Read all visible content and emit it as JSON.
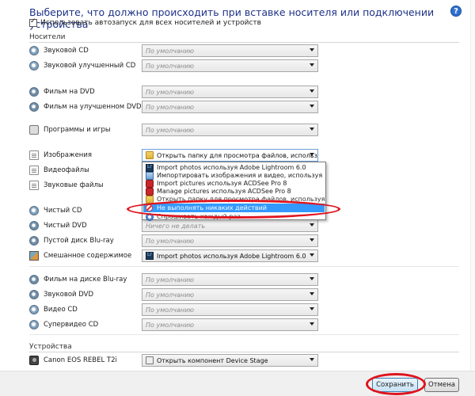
{
  "header": {
    "title": "Выберите, что должно происходить при вставке носителя или подключении устройства",
    "help_label": "?",
    "autoplay_label": "Использовать автозапуск для всех носителей и устройств"
  },
  "sections": {
    "media": "Носители",
    "devices": "Устройства"
  },
  "rows": [
    {
      "label": "Звуковой CD",
      "value": "По умолчанию",
      "icon": "cd-disc-icon"
    },
    {
      "label": "Звуковой улучшенный CD",
      "value": "По умолчанию",
      "icon": "cd-disc-icon"
    },
    {
      "label": "Фильм на DVD",
      "value": "По умолчанию",
      "icon": "dvd-disc-icon"
    },
    {
      "label": "Фильм на улучшенном DVD",
      "value": "По умолчанию",
      "icon": "dvd-disc-icon"
    },
    {
      "label": "Программы и игры",
      "value": "По умолчанию",
      "icon": "program-icon"
    },
    {
      "label": "Изображения",
      "value": "Открыть папку для просмотра файлов, используя Пров",
      "icon": "document-icon"
    },
    {
      "label": "Видеофайлы",
      "value": "",
      "icon": "document-icon"
    },
    {
      "label": "Звуковые файлы",
      "value": "",
      "icon": "document-icon"
    },
    {
      "label": "Чистый CD",
      "value": "",
      "icon": "cd-disc-icon"
    },
    {
      "label": "Чистый DVD",
      "value": "Ничего не делать",
      "icon": "dvd-disc-icon"
    },
    {
      "label": "Пустой диск Blu-ray",
      "value": "По умолчанию",
      "icon": "bluray-disc-icon"
    },
    {
      "label": "Смешанное содержимое",
      "value": "Import photos используя Adobe Lightroom 6.0",
      "icon": "mixed-content-icon"
    },
    {
      "label": "Фильм на диске Blu-ray",
      "value": "По умолчанию",
      "icon": "bluray-disc-icon"
    },
    {
      "label": "Звуковой DVD",
      "value": "По умолчанию",
      "icon": "dvd-disc-icon"
    },
    {
      "label": "Видео CD",
      "value": "По умолчанию",
      "icon": "cd-disc-icon"
    },
    {
      "label": "Супервидео CD",
      "value": "По умолчанию",
      "icon": "cd-disc-icon"
    }
  ],
  "dropdown": {
    "items": [
      {
        "label": "Import photos используя Adobe Lightroom 6.0",
        "icon": "lightroom-icon"
      },
      {
        "label": "Импортировать изображения и видео, используя Windows",
        "icon": "windows-import-icon"
      },
      {
        "label": "Import pictures используя ACDSee Pro 8",
        "icon": "acdsee-icon"
      },
      {
        "label": "Manage pictures используя ACDSee Pro 8",
        "icon": "acdsee-icon"
      },
      {
        "label": "Открыть папку для просмотра файлов, используя Проводник",
        "icon": "folder-icon"
      },
      {
        "label": "Не выполнять никаких действий",
        "icon": "block-icon"
      },
      {
        "label": "Спрашивать каждый раз",
        "icon": "ask-icon"
      }
    ]
  },
  "device_row": {
    "label": "Canon EOS REBEL T2i",
    "value": "Открыть компонент Device Stage"
  },
  "buttons": {
    "save": "Сохранить",
    "cancel": "Отмена"
  },
  "colors": {
    "title": "#1e3287",
    "highlight": "#3399ff",
    "annotation": "#e0141e"
  }
}
